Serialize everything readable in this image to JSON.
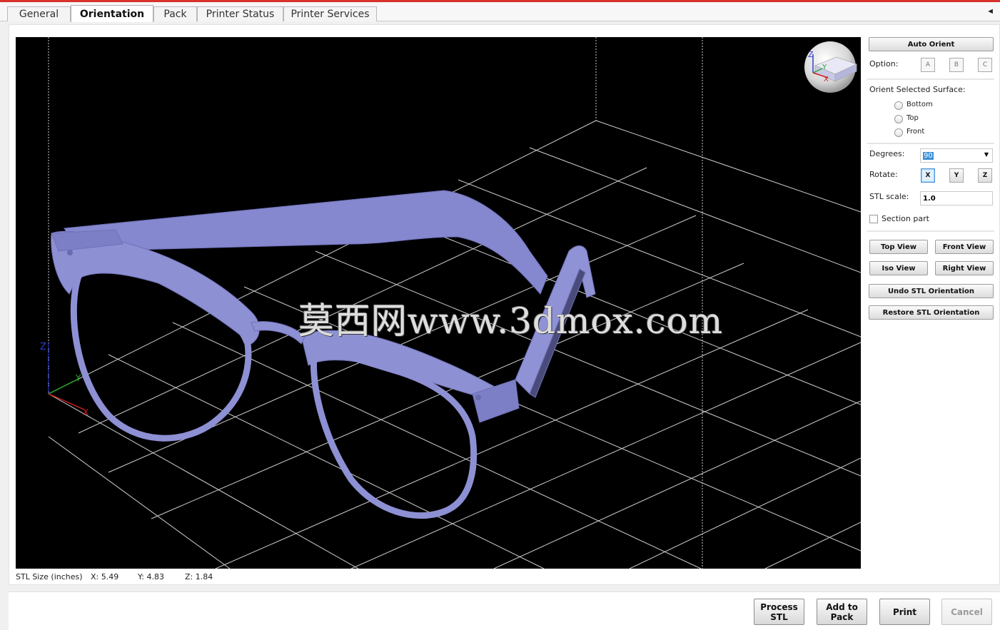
{
  "tabs": [
    "General",
    "Orientation",
    "Pack",
    "Printer Status",
    "Printer Services"
  ],
  "tab_scroll_glyph": "◄",
  "watermark": "莫西网www.3dmox.com",
  "axis_triad": {
    "z": "Z",
    "y": "Y",
    "x": "X"
  },
  "status": {
    "stl_size_label": "STL Size (inches)",
    "x": "X:  5.49",
    "y": "Y:  4.83",
    "z": "Z:  1.84"
  },
  "panel": {
    "auto_orient": "Auto Orient",
    "option_label": "Option:",
    "options": [
      "A",
      "B",
      "C"
    ],
    "orient_surface_label": "Orient Selected Surface:",
    "surfaces": [
      "Bottom",
      "Top",
      "Front"
    ],
    "degrees_label": "Degrees:",
    "degrees_value": "90",
    "rotate_label": "Rotate:",
    "rotate_axes": [
      "X",
      "Y",
      "Z"
    ],
    "rotate_selected": "X",
    "stl_scale_label": "STL scale:",
    "stl_scale_value": "1.0",
    "section_part": "Section part",
    "top_view": "Top View",
    "front_view": "Front View",
    "iso_view": "Iso View",
    "right_view": "Right View",
    "undo_orientation": "Undo STL Orientation",
    "restore_orientation": "Restore STL Orientation"
  },
  "bottom": {
    "process": "Process\nSTL",
    "add_to_pack": "Add to\nPack",
    "print": "Print",
    "cancel": "Cancel"
  },
  "colors": {
    "model": "#8e90d4",
    "grid": "#d8d8d8",
    "accent": "#d9312b"
  }
}
